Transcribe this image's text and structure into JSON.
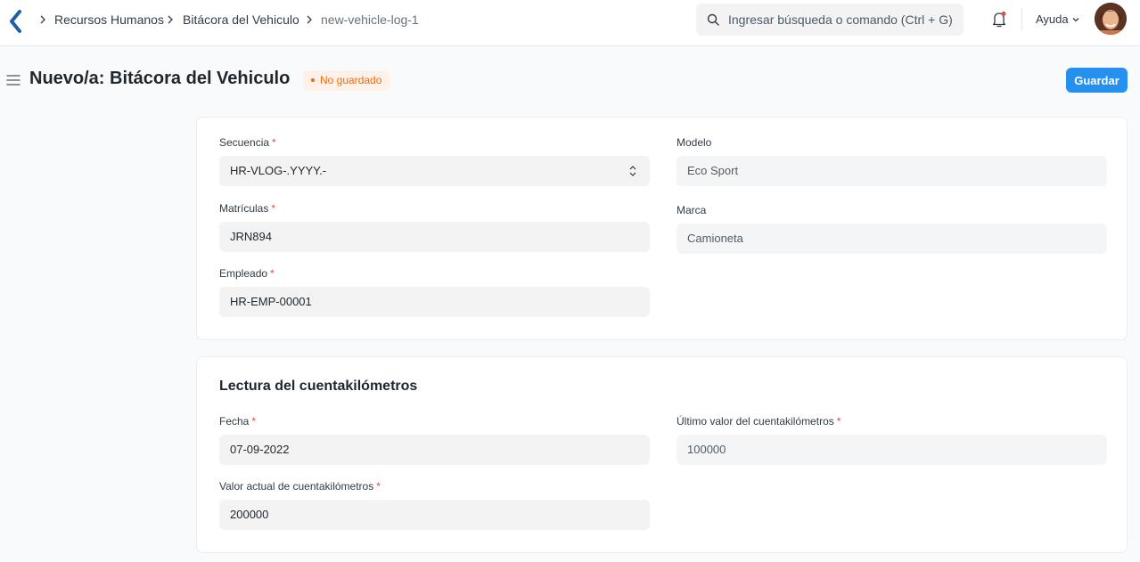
{
  "navbar": {
    "breadcrumbs": [
      "Recursos Humanos",
      "Bitácora del Vehiculo",
      "new-vehicle-log-1"
    ],
    "search_placeholder": "Ingresar búsqueda o comando (Ctrl + G)",
    "help_label": "Ayuda"
  },
  "page": {
    "title": "Nuevo/a: Bitácora del Vehiculo",
    "status": "No guardado",
    "save_label": "Guardar"
  },
  "details": {
    "sequence": {
      "label": "Secuencia",
      "value": "HR-VLOG-.YYYY.-"
    },
    "plates": {
      "label": "Matrículas",
      "value": "JRN894"
    },
    "employee": {
      "label": "Empleado",
      "value": "HR-EMP-00001"
    },
    "model": {
      "label": "Modelo",
      "value": "Eco Sport"
    },
    "make": {
      "label": "Marca",
      "value": "Camioneta"
    }
  },
  "odometer": {
    "title": "Lectura del cuentakilómetros",
    "date": {
      "label": "Fecha",
      "value": "07-09-2022"
    },
    "current": {
      "label": "Valor actual de cuentakilómetros",
      "value": "200000"
    },
    "last": {
      "label": "Último valor del cuentakilómetros",
      "value": "100000"
    }
  },
  "colors": {
    "primary": "#2490ef",
    "status_text": "#e86c13",
    "status_bg": "#fff1e7",
    "required": "#e24c4c"
  },
  "icons": [
    "app-logo-icon",
    "chevron-right-icon",
    "search-icon",
    "bell-icon",
    "chevron-down-icon",
    "hamburger-icon",
    "select-arrows-icon"
  ]
}
